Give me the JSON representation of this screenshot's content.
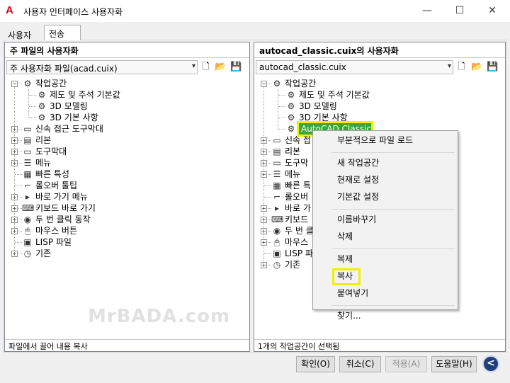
{
  "window": {
    "title": "사용자 인터페이스 사용자화",
    "app_icon": "A",
    "controls": {
      "minimize": "—",
      "maximize": "☐",
      "close": "✕"
    }
  },
  "tabs": [
    {
      "label": "사용자화"
    },
    {
      "label": "전송"
    }
  ],
  "left_pane": {
    "header": "주 파일의 사용자화",
    "combo_value": "주 사용자화 파일(acad.cuix)",
    "tree": [
      {
        "label": "작업공간",
        "icon": "workspace-icon",
        "exp": "−"
      },
      {
        "label": "제도 및 주석 기본값",
        "icon": "gear-icon"
      },
      {
        "label": "3D 모델링",
        "icon": "gear-icon"
      },
      {
        "label": "3D 기본 사항",
        "icon": "gear-icon"
      },
      {
        "label": "신속 접근 도구막대",
        "icon": "toolbar-icon",
        "exp": "+"
      },
      {
        "label": "리본",
        "icon": "ribbon-icon",
        "exp": "+"
      },
      {
        "label": "도구막대",
        "icon": "toolbar-icon",
        "exp": "+"
      },
      {
        "label": "메뉴",
        "icon": "menu-icon",
        "exp": "+"
      },
      {
        "label": "빠른 특성",
        "icon": "quick-properties-icon"
      },
      {
        "label": "롤오버 툴팁",
        "icon": "tooltip-icon"
      },
      {
        "label": "바로 가기 메뉴",
        "icon": "shortcut-menu-icon",
        "exp": "+"
      },
      {
        "label": "키보드 바로 가기",
        "icon": "keyboard-icon",
        "exp": "+"
      },
      {
        "label": "두 번 클릭 동작",
        "icon": "double-click-icon",
        "exp": "+"
      },
      {
        "label": "마우스 버튼",
        "icon": "mouse-icon",
        "exp": "+"
      },
      {
        "label": "LISP 파일",
        "icon": "lisp-icon"
      },
      {
        "label": "기존",
        "icon": "legacy-icon",
        "exp": "+"
      }
    ],
    "status": "파일에서 끌어 내용 복사"
  },
  "right_pane": {
    "header": "autocad_classic.cuix의 사용자화",
    "combo_value": "autocad_classic.cuix",
    "tree": [
      {
        "label": "작업공간",
        "icon": "workspace-icon",
        "exp": "−"
      },
      {
        "label": "제도 및 주석 기본값",
        "icon": "gear-icon"
      },
      {
        "label": "3D 모델링",
        "icon": "gear-icon"
      },
      {
        "label": "3D 기본 사항",
        "icon": "gear-icon"
      },
      {
        "label": "AutoCAD Classic",
        "icon": "gear-icon",
        "selected": true
      },
      {
        "label": "신속 접",
        "icon": "toolbar-icon",
        "exp": "+"
      },
      {
        "label": "리본",
        "icon": "ribbon-icon",
        "exp": "+"
      },
      {
        "label": "도구막",
        "icon": "toolbar-icon",
        "exp": "+"
      },
      {
        "label": "메뉴",
        "icon": "menu-icon",
        "exp": "+"
      },
      {
        "label": "빠른 특",
        "icon": "quick-properties-icon"
      },
      {
        "label": "롤오버",
        "icon": "tooltip-icon"
      },
      {
        "label": "바로 가",
        "icon": "shortcut-menu-icon",
        "exp": "+"
      },
      {
        "label": "키보드",
        "icon": "keyboard-icon",
        "exp": "+"
      },
      {
        "label": "두 번 클",
        "icon": "double-click-icon",
        "exp": "+"
      },
      {
        "label": "마우스",
        "icon": "mouse-icon",
        "exp": "+"
      },
      {
        "label": "LISP 파",
        "icon": "lisp-icon"
      },
      {
        "label": "기존",
        "icon": "legacy-icon",
        "exp": "+"
      }
    ],
    "status": "1개의 작업공간이 선택됨"
  },
  "context_menu": {
    "groups": [
      [
        "부분적으로 파일 로드"
      ],
      [
        "새 작업공간",
        "현재로 설정",
        "기본값 설정"
      ],
      [
        "이름바꾸기",
        "삭제"
      ],
      [
        "복제",
        "복사",
        "붙여넣기"
      ],
      [
        "찾기..."
      ]
    ],
    "highlighted": "복사"
  },
  "watermark": "MrBADA.com",
  "buttons": {
    "ok": "확인(O)",
    "cancel": "취소(C)",
    "apply": "적용(A)",
    "help": "도움말(H)",
    "nav": "<"
  },
  "colors": {
    "highlight_box": "#f0f000",
    "selection_fill": "#3aa53a",
    "nav_button": "#1f3e7a",
    "app_icon": "#d0021b"
  }
}
